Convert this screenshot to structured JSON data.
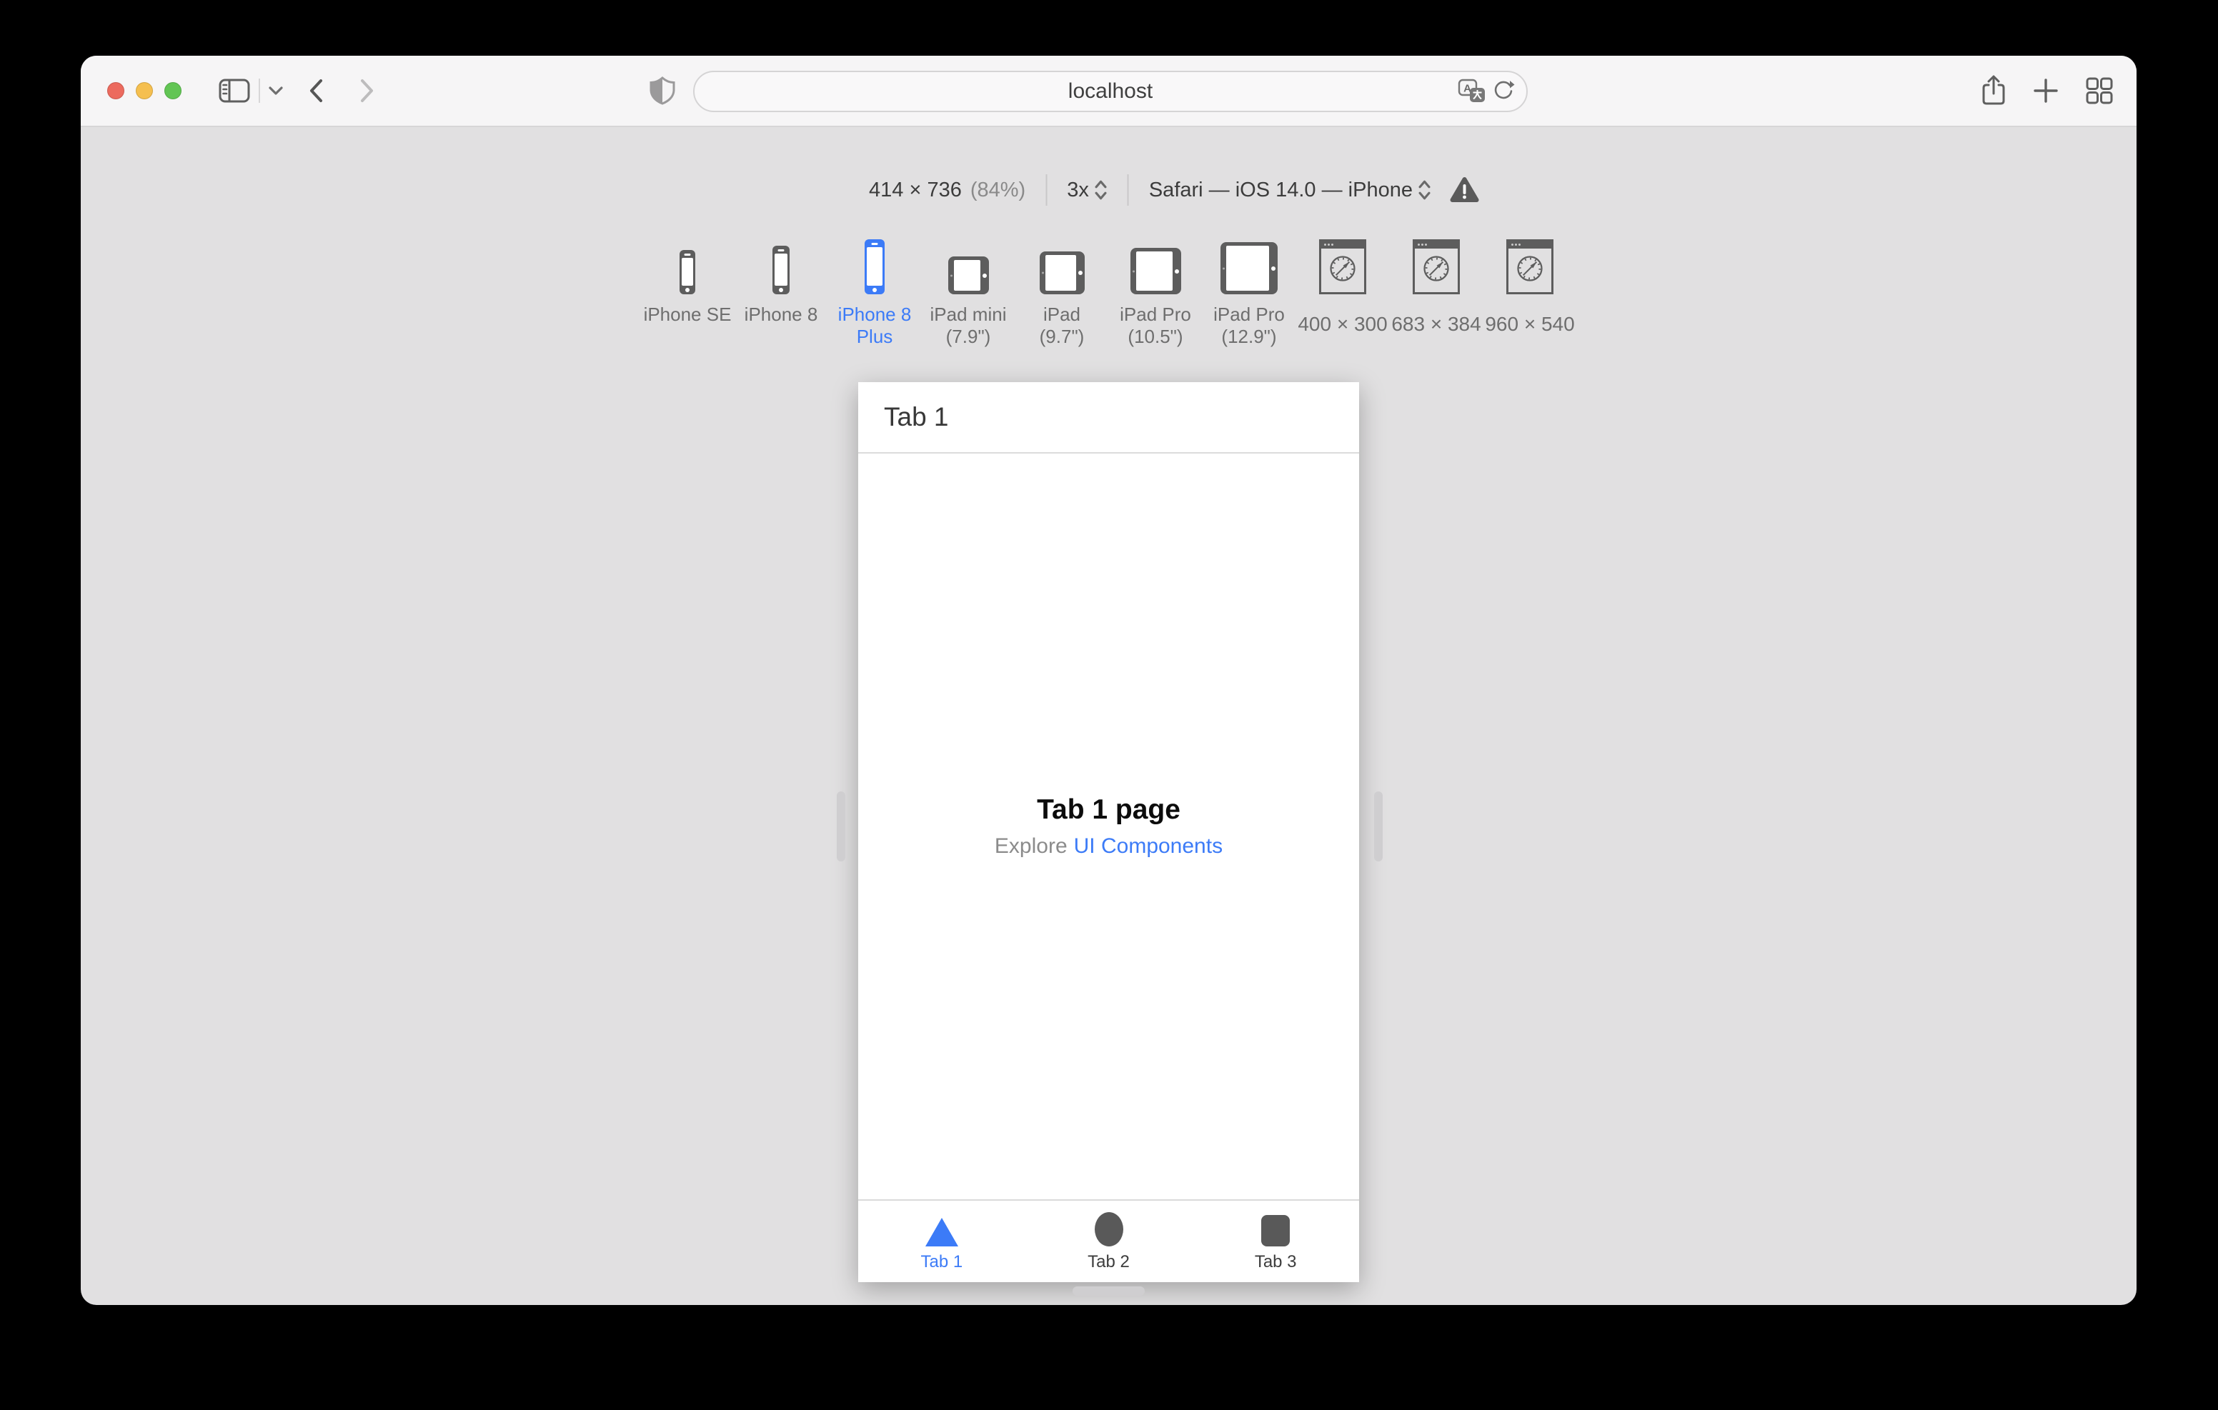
{
  "accent_color": "#3c7bf7",
  "toolbar": {
    "url": "localhost"
  },
  "controls": {
    "size": "414 × 736",
    "zoom": "(84%)",
    "scale": "3x",
    "user_agent": "Safari — iOS 14.0 — iPhone"
  },
  "devices": [
    {
      "label1": "iPhone SE",
      "label2": ""
    },
    {
      "label1": "iPhone 8",
      "label2": ""
    },
    {
      "label1": "iPhone 8",
      "label2": "Plus"
    },
    {
      "label1": "iPad mini",
      "label2": "(7.9\")"
    },
    {
      "label1": "iPad",
      "label2": "(9.7\")"
    },
    {
      "label1": "iPad Pro",
      "label2": "(10.5\")"
    },
    {
      "label1": "iPad Pro",
      "label2": "(12.9\")"
    },
    {
      "label1": "400 × 300",
      "label2": ""
    },
    {
      "label1": "683 × 384",
      "label2": ""
    },
    {
      "label1": "960 × 540",
      "label2": ""
    }
  ],
  "viewport": {
    "nav_title": "Tab 1",
    "page_title": "Tab 1 page",
    "subtitle_prefix": "Explore",
    "subtitle_link": "UI Components",
    "tabs": [
      {
        "label": "Tab 1"
      },
      {
        "label": "Tab 2"
      },
      {
        "label": "Tab 3"
      }
    ]
  }
}
